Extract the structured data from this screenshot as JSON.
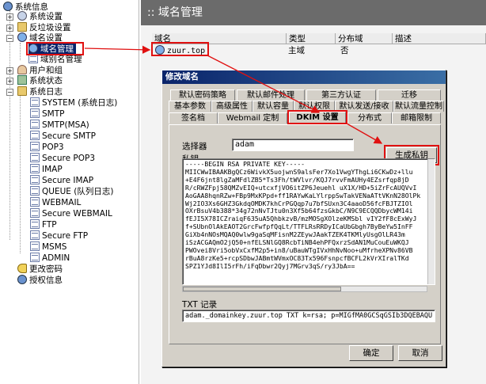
{
  "tree": {
    "items": [
      {
        "label": "系统信息",
        "icon": "info-icon"
      },
      {
        "label": "系统设置",
        "icon": "gear-icon"
      },
      {
        "label": "反垃圾设置",
        "icon": "folder-icon"
      },
      {
        "label": "域名设置",
        "icon": "globe-icon"
      },
      {
        "label": "域名管理",
        "icon": "globe-icon"
      },
      {
        "label": "域别名管理",
        "icon": "doc-icon"
      },
      {
        "label": "用户和组",
        "icon": "user-icon"
      },
      {
        "label": "系统状态",
        "icon": "chart-icon"
      },
      {
        "label": "系统日志",
        "icon": "folder-icon"
      },
      {
        "label": "SYSTEM (系统日志)",
        "icon": "doc-icon"
      },
      {
        "label": "SMTP",
        "icon": "doc-icon"
      },
      {
        "label": "SMTP(MSA)",
        "icon": "doc-icon"
      },
      {
        "label": "Secure SMTP",
        "icon": "doc-icon"
      },
      {
        "label": "POP3",
        "icon": "doc-icon"
      },
      {
        "label": "Secure POP3",
        "icon": "doc-icon"
      },
      {
        "label": "IMAP",
        "icon": "doc-icon"
      },
      {
        "label": "Secure IMAP",
        "icon": "doc-icon"
      },
      {
        "label": "QUEUE (队列日志)",
        "icon": "doc-icon"
      },
      {
        "label": "WEBMAIL",
        "icon": "doc-icon"
      },
      {
        "label": "Secure WEBMAIL",
        "icon": "doc-icon"
      },
      {
        "label": "FTP",
        "icon": "doc-icon"
      },
      {
        "label": "Secure FTP",
        "icon": "doc-icon"
      },
      {
        "label": "MSMS",
        "icon": "doc-icon"
      },
      {
        "label": "ADMIN",
        "icon": "doc-icon"
      },
      {
        "label": "更改密码",
        "icon": "key-icon"
      },
      {
        "label": "授权信息",
        "icon": "info-icon"
      }
    ]
  },
  "header": {
    "title": ":: 域名管理"
  },
  "list": {
    "columns": [
      "域名",
      "类型",
      "分布域",
      "描述"
    ],
    "rows": [
      {
        "domain": "zuur.top",
        "type": "主域",
        "distributed": "否",
        "desc": ""
      }
    ]
  },
  "dialog": {
    "title": "修改域名",
    "tabs_row1": [
      "默认密码策略",
      "默认邮件处理",
      "第三方认证",
      "迁移"
    ],
    "tabs_row2": [
      "基本参数",
      "高级属性",
      "默认容量",
      "默认权限",
      "默认发送/接收",
      "默认流量控制"
    ],
    "tabs_row3": [
      "签名档",
      "Webmail 定制",
      "DKIM 设置",
      "分布式",
      "邮箱限制"
    ],
    "selector_label": "选择器",
    "selector_value": "adam",
    "generate_button": "生成私钥",
    "key_label": "私钥",
    "key_lines": [
      "-----BEGIN RSA PRIVATE KEY-----",
      "MIICWwIBAAKBgQCz6WivkX5uojwnS9alsFer7Xo1VwgYThgLi6CKwDz+llu",
      "+E4F6jnt8lgZaMFdlZB5*Ts3Fh/tWVlvr/KQJ7rvvFmAUHy4EZsrfqp8jD",
      "R/cRWZFpj58QMZvEIQ+utcxfjVO6itZP6Jeuehl uX1X/HD+5iZrFcAUQVvI",
      "AoGAA8hqnRZw+FBp9MxKPpd+ff1RAYwKaLYlrppSwTakVENaATtVKnN28OlPk",
      "Wj2IO3Xs6GHZ3GkdqOMDK7khCrPGQqp7u7bfSUxn3C4aaoD56fcFBJTZIOl",
      "OXrBsuV4b388*34g72nNvTJtu0n3Xf5b64fzsGkbC/N9C9ECQQDbycWM14i",
      "fEJI5X78ICZraiqF635uA5QhbkzvB/mzMOSgXOlzeKMSbl vIY2fF8cExWyJ",
      "f+SUbnOlAkEAOT2GrcFwfpfQqLt/TTFLRsRRDyICaUbGbgh7ByBeYw5InFF",
      "GiXb4nNOsMQAQ0wlw9gaSqMFisnM2ZEywJAakTZEK4TKMlyUsgOlLR43m",
      "iSzACGAQmO2jQ50+nfELSNlGQ8RcbTiNB4ehPFQxrzSdAN1MuCouEuWKQJ",
      "PWOvei8Vri5obVxCxfM2p5+in8/uBauWTgIVxHhNvNoo+uMfrheXPNv86VB",
      "rBuA8rzKe5+rcpSDbwJABmtWVmxOC83Tx596FsnpcfBCFL2kVrXIralTKd",
      "SPZ1YJd8IlI5rFh/iFqDbwr2Qyj7MGrv3qS/ry3JbA=="
    ],
    "txt_label": "TXT 记录",
    "txt_value": "adam._domainkey.zuur.top  TXT k=rsa; p=MIGfMA0GCSqGSIb3DQEBAQU",
    "ok_button": "确定",
    "cancel_button": "取消"
  },
  "colors": {
    "annotation": "#e01010",
    "header_bg": "#6b6b6b",
    "dialog_bg": "#d4d0c8",
    "title_bar": "#0a246a"
  }
}
